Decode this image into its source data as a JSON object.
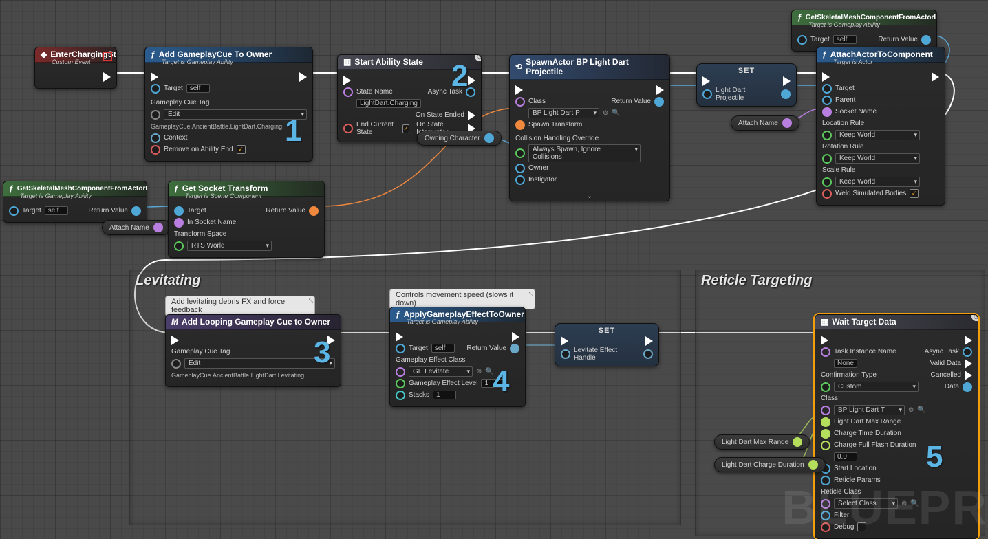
{
  "groups": {
    "levitating": "Levitating",
    "reticle": "Reticle Targeting"
  },
  "enterCharging": {
    "title": "EnterChargingState",
    "subtitle": "Custom Event"
  },
  "addCue": {
    "title": "Add GameplayCue To Owner",
    "subtitle": "Target is Gameplay Ability",
    "target": "Target",
    "self": "self",
    "tagLabel": "Gameplay Cue Tag",
    "tagEdit": "Edit",
    "tagPath": "GameplayCue.AncientBattle.LightDart.Charging",
    "context": "Context",
    "remove": "Remove on Ability End"
  },
  "startState": {
    "title": "Start Ability State",
    "stateLabel": "State Name",
    "stateValue": "LightDart.Charging",
    "endCurrent": "End Current State",
    "async": "Async Task",
    "onEnded": "On State Ended",
    "onInterrupted": "On State Interrupted"
  },
  "owningChar": "Owning Character",
  "spawn": {
    "title": "SpawnActor BP Light Dart Projectile",
    "class": "Class",
    "classValue": "BP Light Dart P",
    "xform": "Spawn Transform",
    "collision": "Collision Handling Override",
    "collisionValue": "Always Spawn, Ignore Collisions",
    "owner": "Owner",
    "instigator": "Instigator",
    "return": "Return Value"
  },
  "set1": {
    "title": "SET",
    "pin": "Light Dart Projectile"
  },
  "getMesh": {
    "title": "GetSkeletalMeshComponentFromActorInfo",
    "subtitle": "Target is Gameplay Ability",
    "target": "Target",
    "self": "self",
    "return": "Return Value"
  },
  "attach": {
    "title": "AttachActorToComponent",
    "subtitle": "Target is Actor",
    "target": "Target",
    "parent": "Parent",
    "socket": "Socket Name",
    "locRule": "Location Rule",
    "rotRule": "Rotation Rule",
    "scaleRule": "Scale Rule",
    "ruleValue": "Keep World",
    "weld": "Weld Simulated Bodies"
  },
  "attachName": "Attach Name",
  "getSocket": {
    "title": "Get Socket Transform",
    "subtitle": "Target is Scene Component",
    "target": "Target",
    "socket": "In Socket Name",
    "space": "Transform Space",
    "spaceValue": "RTS World",
    "return": "Return Value"
  },
  "comments": {
    "debris": "Add levitating debris FX and force feedback",
    "movement": "Controls movement speed (slows it down)"
  },
  "addLoopCue": {
    "title": "Add Looping Gameplay Cue to Owner",
    "tagLabel": "Gameplay Cue Tag",
    "tagEdit": "Edit",
    "tagPath": "GameplayCue.AncientBattle.LightDart.Levitating"
  },
  "applyGE": {
    "title": "ApplyGameplayEffectToOwner",
    "subtitle": "Target is Gameplay Ability",
    "target": "Target",
    "self": "self",
    "geClass": "Gameplay Effect Class",
    "geValue": "GE Levitate",
    "geLevel": "Gameplay Effect Level",
    "geLevelValue": "1",
    "stacks": "Stacks",
    "stacksValue": "1",
    "return": "Return Value"
  },
  "set2": {
    "title": "SET",
    "pin": "Levitate Effect Handle"
  },
  "waitTarget": {
    "title": "Wait Target Data",
    "taskName": "Task Instance Name",
    "taskValue": "None",
    "confirm": "Confirmation Type",
    "confirmValue": "Custom",
    "class": "Class",
    "classValue": "BP Light Dart T",
    "maxRange": "Light Dart Max Range",
    "chargeTime": "Charge Time Duration",
    "flash": "Charge Full Flash Duration",
    "flashValue": "0.0",
    "startLoc": "Start Location",
    "params": "Reticle Params",
    "reticleClass": "Reticle Class",
    "reticleClassValue": "Select Class",
    "filter": "Filter",
    "debug": "Debug",
    "async": "Async Task",
    "valid": "Valid Data",
    "cancelled": "Cancelled",
    "data": "Data"
  },
  "maxRangePill": "Light Dart Max Range",
  "chargeDurationPill": "Light Dart Charge Duration",
  "numbers": {
    "n1": "1",
    "n2": "2",
    "n3": "3",
    "n4": "4",
    "n5": "5"
  },
  "watermark": "BLUEPR"
}
